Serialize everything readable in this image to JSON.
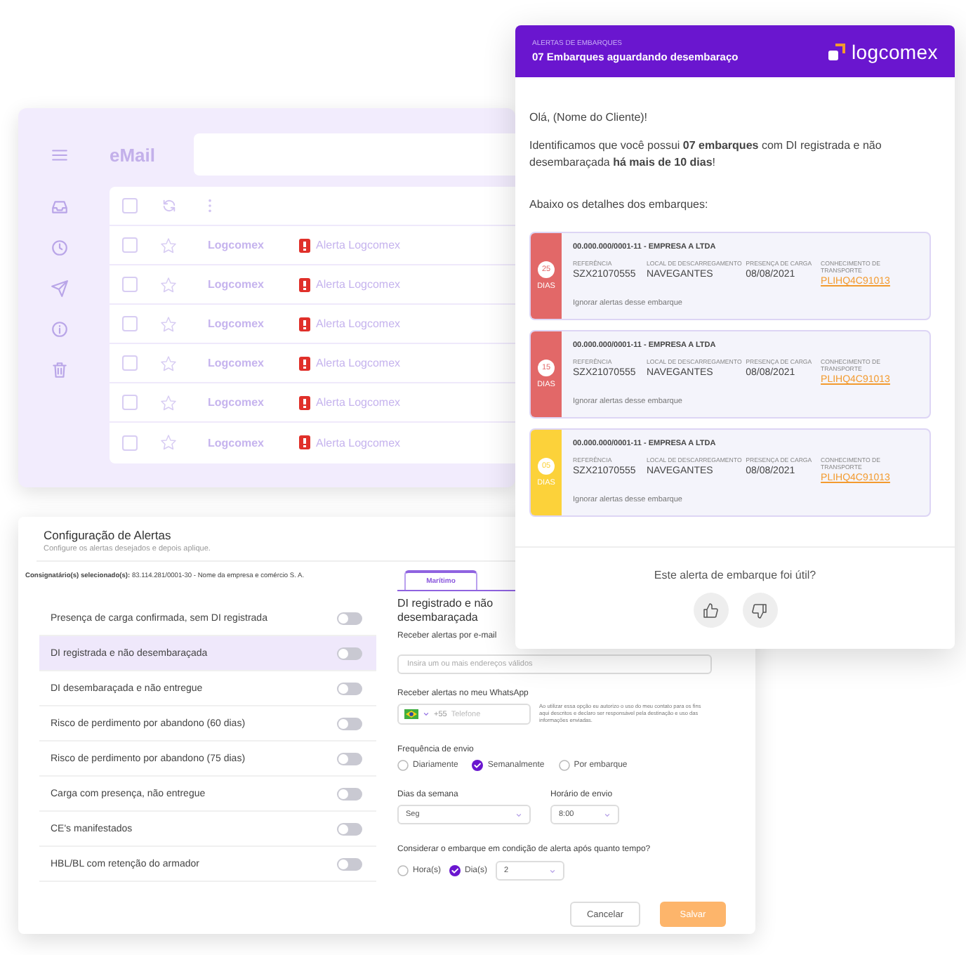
{
  "email_window": {
    "title": "eMail",
    "select_all_checked": false,
    "rows": [
      {
        "sender": "Logcomex",
        "subject": "Alerta Logcomex",
        "checked": false
      },
      {
        "sender": "Logcomex",
        "subject": "Alerta Logcomex",
        "checked": false
      },
      {
        "sender": "Logcomex",
        "subject": "Alerta Logcomex",
        "checked": false
      },
      {
        "sender": "Logcomex",
        "subject": "Alerta Logcomex",
        "checked": false
      },
      {
        "sender": "Logcomex",
        "subject": "Alerta Logcomex",
        "checked": false
      },
      {
        "sender": "Logcomex",
        "subject": "Alerta Logcomex",
        "checked": false
      }
    ]
  },
  "alert_email": {
    "kicker": "ALERTAS DE EMBARQUES",
    "title": "07 Embarques aguardando desembaraço",
    "logo": "logcomex",
    "greeting": "Olá, (Nome do Cliente)!",
    "message": "Identificamos que você possui **07 embarques** com DI registrada e não desembaraçada **há mais de 10 dias**!",
    "intro": "Abaixo os detalhes dos embarques:",
    "shipments": [
      {
        "days": "25",
        "days_label": "DIAS",
        "color": "#e26868",
        "company": "00.000.000/0001-11  - EMPRESA A LTDA",
        "fields": [
          {
            "label": "REFERÊNCIA",
            "value": "SZX21070555",
            "kind": "text"
          },
          {
            "label": "LOCAL DE DESCARREGAMENTO",
            "value": "NAVEGANTES",
            "kind": "text"
          },
          {
            "label": "PRESENÇA DE CARGA",
            "value": "08/08/2021",
            "kind": "text"
          },
          {
            "label": "CONHECIMENTO DE TRANSPORTE",
            "value": "PLIHQ4C91013",
            "kind": "link"
          }
        ],
        "ignore": "Ignorar alertas desse embarque"
      },
      {
        "days": "15",
        "days_label": "DIAS",
        "color": "#e26868",
        "company": "00.000.000/0001-11  - EMPRESA A LTDA",
        "fields": [
          {
            "label": "REFERÊNCIA",
            "value": "SZX21070555",
            "kind": "text"
          },
          {
            "label": "LOCAL DE DESCARREGAMENTO",
            "value": "NAVEGANTES",
            "kind": "text"
          },
          {
            "label": "PRESENÇA DE CARGA",
            "value": "08/08/2021",
            "kind": "text"
          },
          {
            "label": "CONHECIMENTO DE TRANSPORTE",
            "value": "PLIHQ4C91013",
            "kind": "link"
          }
        ],
        "ignore": "Ignorar alertas desse embarque"
      },
      {
        "days": "05",
        "days_label": "DIAS",
        "color": "#fcd23a",
        "company": "00.000.000/0001-11  - EMPRESA A LTDA",
        "fields": [
          {
            "label": "REFERÊNCIA",
            "value": "SZX21070555",
            "kind": "text"
          },
          {
            "label": "LOCAL DE DESCARREGAMENTO",
            "value": "NAVEGANTES",
            "kind": "text"
          },
          {
            "label": "PRESENÇA DE CARGA",
            "value": "08/08/2021",
            "kind": "text"
          },
          {
            "label": "CONHECIMENTO DE TRANSPORTE",
            "value": "PLIHQ4C91013",
            "kind": "link"
          }
        ],
        "ignore": "Ignorar alertas desse embarque"
      }
    ],
    "feedback_question": "Este alerta de embarque foi útil?"
  },
  "config": {
    "title": "Configuração de Alertas",
    "subtitle": "Configure os alertas desejados e depois aplique.",
    "consignee": "**Consignatário(s) selecionado(s):** 83.114.281/0001-30 - Nome da empresa e comércio S. A.",
    "alerts": [
      {
        "label": "Presença de carga confirmada, sem DI registrada",
        "selected": false,
        "on": false
      },
      {
        "label": "DI registrada e não desembaraçada",
        "selected": true,
        "on": false
      },
      {
        "label": "DI desembaraçada e não entregue",
        "selected": false,
        "on": false
      },
      {
        "label": "Risco de perdimento por abandono (60 dias)",
        "selected": false,
        "on": false
      },
      {
        "label": "Risco de perdimento por abandono (75 dias)",
        "selected": false,
        "on": false
      },
      {
        "label": "Carga com presença, não entregue",
        "selected": false,
        "on": false
      },
      {
        "label": "CE's manifestados",
        "selected": false,
        "on": false
      },
      {
        "label": "HBL/BL com retenção do armador",
        "selected": false,
        "on": false
      }
    ],
    "tabs": [
      {
        "label": "Marítimo",
        "selected": true
      }
    ],
    "form": {
      "heading": "DI registrado e não desembaraçada",
      "email_label": "Receber alertas por e-mail",
      "email_placeholder": "Insira um ou mais endereços válidos",
      "whatsapp_label": "Receber alertas no meu WhatsApp",
      "country_code": "+55",
      "phone_placeholder": "Telefone",
      "whatsapp_note": "Ao utilizar essa opção eu autorizo o uso do meu contato para os fins aqui descritos e declaro ser responsável pela destinação e uso das informações enviadas.",
      "frequency_label": "Frequência de envio",
      "frequency_options": [
        {
          "label": "Diariamente",
          "selected": false
        },
        {
          "label": "Semanalmente",
          "selected": true
        },
        {
          "label": "Por embarque",
          "selected": false
        }
      ],
      "weekday_label": "Dias da semana",
      "weekday_value": "Seg",
      "time_label": "Horário de envio",
      "time_value": "8:00",
      "threshold_label": "Considerar o embarque em condição de alerta após quanto tempo?",
      "unit_options": [
        {
          "label": "Hora(s)",
          "selected": false
        },
        {
          "label": "Dia(s)",
          "selected": true
        }
      ],
      "threshold_value": "2"
    },
    "buttons": [
      {
        "label": "Cancelar",
        "kind": "secondary"
      },
      {
        "label": "Salvar",
        "kind": "primary"
      }
    ]
  }
}
